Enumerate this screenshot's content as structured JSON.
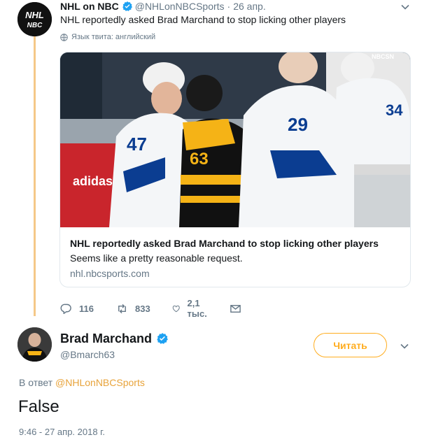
{
  "tweet": {
    "display_name": "NHL on NBC",
    "handle": "@NHLonNBCSports",
    "separator": "·",
    "date": "26 апр.",
    "text": "NHL reportedly asked Brad Marchand to stop licking other players",
    "language_note": "Язык твита: английский",
    "avatar_text": "NHL NBC",
    "card": {
      "title": "NHL reportedly asked Brad Marchand to stop licking other players",
      "description": "Seems like a pretty reasonable request.",
      "domain": "nhl.nbcsports.com",
      "image_overlay_text": {
        "logo": "NBCSN",
        "board_ad": "adidas",
        "jersey_numbers": [
          "47",
          "63",
          "29",
          "34"
        ]
      }
    },
    "stats": {
      "replies": "116",
      "retweets": "833",
      "likes": "2,1 тыс."
    }
  },
  "reply": {
    "display_name": "Brad Marchand",
    "handle": "@Bmarch63",
    "follow_label": "Читать",
    "reply_prefix": "В ответ",
    "reply_mention": "@NHLonNBCSports",
    "text": "False",
    "timestamp": "9:46 - 27 апр. 2018 г."
  },
  "colors": {
    "accent": "#ffad1f",
    "verified": "#1da1f2",
    "thread_line": "#f5c888",
    "muted": "#657786"
  },
  "icons": [
    "verified-badge-icon",
    "chevron-down-icon",
    "globe-icon",
    "reply-icon",
    "retweet-icon",
    "heart-icon",
    "direct-message-icon"
  ]
}
